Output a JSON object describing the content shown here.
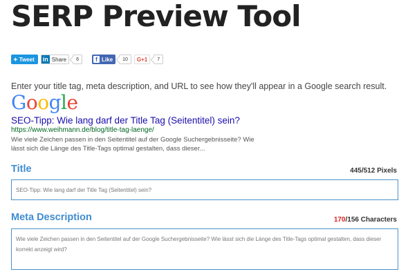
{
  "header": {
    "title": "SERP Preview Tool"
  },
  "share": {
    "tweet_label": "Tweet",
    "linkedin_label": "Share",
    "linkedin_count": "6",
    "facebook_label": "Like",
    "facebook_count": "10",
    "gplus_label": "G+1",
    "gplus_count": "7"
  },
  "instructions": "Enter your title tag, meta description, and URL to see how they'll appear in a Google search result.",
  "preview": {
    "logo_text": "Google",
    "title": "SEO-Tipp: Wie lang darf der Title Tag (Seitentitel) sein?",
    "url": "https://www.weihmann.de/blog/title-tag-laenge/",
    "description": "Wie viele Zeichen passen in den Seitentitel auf der Google Suchergebnisseite? Wie lässt sich die Länge des Title-Tags optimal gestalten, dass dieser..."
  },
  "title_field": {
    "label": "Title",
    "count": "445",
    "limit": "/512 Pixels",
    "value": "SEO-Tipp: Wie lang darf der Title Tag (Seitentitel) sein?"
  },
  "meta_field": {
    "label": "Meta Description",
    "count": "170",
    "limit": "/156 Characters",
    "value": "Wie viele Zeichen passen in den Seitentitel auf der Google Suchergebnisseite? Wie lässt sich die Länge des Title-Tags optimal gestalten, dass dieser korrekt anzeigt wird?"
  },
  "colors": {
    "link_blue": "#1a0dab",
    "url_green": "#006621",
    "label_blue": "#3f8dd0",
    "over_limit_red": "#e02020"
  }
}
